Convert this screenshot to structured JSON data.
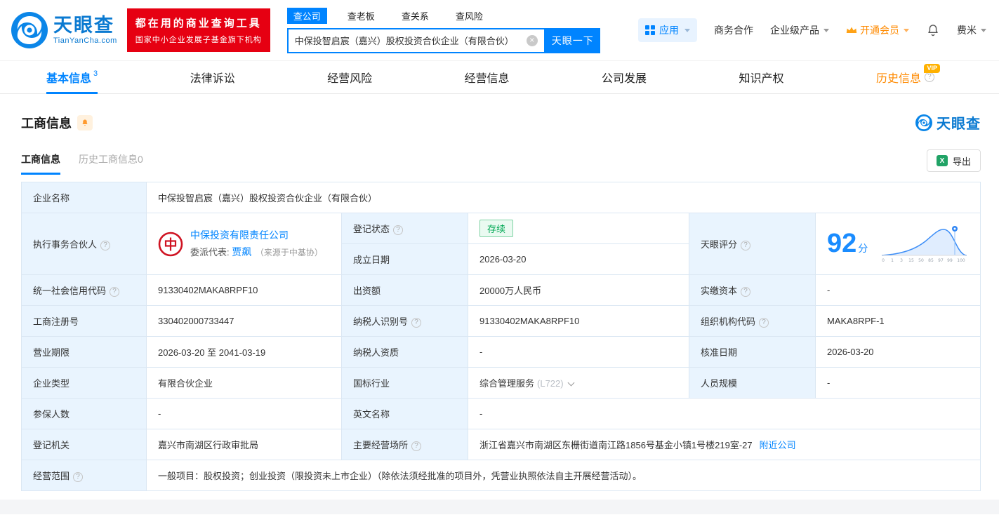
{
  "header": {
    "logo": {
      "brand": "天眼查",
      "domain": "TianYanCha.com"
    },
    "promo": {
      "line1": "都在用的商业查询工具",
      "line2": "国家中小企业发展子基金旗下机构"
    },
    "search": {
      "tabs": [
        {
          "label": "查公司"
        },
        {
          "label": "查老板"
        },
        {
          "label": "查关系"
        },
        {
          "label": "查风险"
        }
      ],
      "value": "中保投智启宸（嘉兴）股权投资合伙企业（有限合伙）",
      "button": "天眼一下"
    },
    "nav": {
      "apps": "应用",
      "business": "商务合作",
      "enterprise": "企业级产品",
      "vip": "开通会员",
      "user": "费米"
    }
  },
  "nav_tabs": [
    {
      "label": "基本信息",
      "count": "3"
    },
    {
      "label": "法律诉讼"
    },
    {
      "label": "经营风险"
    },
    {
      "label": "经营信息"
    },
    {
      "label": "公司发展"
    },
    {
      "label": "知识产权"
    },
    {
      "label": "历史信息",
      "badge": "VIP"
    }
  ],
  "section": {
    "title": "工商信息",
    "brand": "天眼查",
    "subtabs": [
      {
        "label": "工商信息"
      },
      {
        "label": "历史工商信息0"
      }
    ],
    "export_label": "导出"
  },
  "info": {
    "company_name_label": "企业名称",
    "company_name": "中保投智启宸（嘉兴）股权投资合伙企业（有限合伙）",
    "partner_label": "执行事务合伙人",
    "partner_company": "中保投资有限责任公司",
    "partner_rep_label": "委派代表:",
    "partner_rep": "贾飙",
    "partner_rep_source": "（来源于中基协）",
    "reg_status_label": "登记状态",
    "reg_status": "存续",
    "est_date_label": "成立日期",
    "est_date": "2026-03-20",
    "score_label": "天眼评分",
    "score": "92",
    "score_unit": "分",
    "score_axis": [
      "0",
      "1",
      "3",
      "15",
      "50",
      "85",
      "97",
      "99",
      "100"
    ],
    "credit_code_label": "统一社会信用代码",
    "credit_code": "91330402MAKA8RPF10",
    "capital_label": "出资额",
    "capital": "20000万人民币",
    "paid_capital_label": "实缴资本",
    "paid_capital": "-",
    "reg_no_label": "工商注册号",
    "reg_no": "330402000733447",
    "tax_id_label": "纳税人识别号",
    "tax_id": "91330402MAKA8RPF10",
    "org_code_label": "组织机构代码",
    "org_code": "MAKA8RPF-1",
    "term_label": "营业期限",
    "term": "2026-03-20 至 2041-03-19",
    "tax_quality_label": "纳税人资质",
    "tax_quality": "-",
    "approval_date_label": "核准日期",
    "approval_date": "2026-03-20",
    "company_type_label": "企业类型",
    "company_type": "有限合伙企业",
    "industry_label": "国标行业",
    "industry": "综合管理服务",
    "industry_code": "(L722)",
    "staff_size_label": "人员规模",
    "staff_size": "-",
    "insured_label": "参保人数",
    "insured": "-",
    "english_name_label": "英文名称",
    "english_name": "-",
    "authority_label": "登记机关",
    "authority": "嘉兴市南湖区行政审批局",
    "address_label": "主要经营场所",
    "address": "浙江省嘉兴市南湖区东栅街道南江路1856号基金小镇1号楼219室-27",
    "nearby_link": "附近公司",
    "scope_label": "经营范围",
    "scope": "一般项目：股权投资；创业投资（限投资未上市企业）（除依法须经批准的项目外，凭营业执照依法自主开展经营活动）。"
  },
  "colors": {
    "accent_blue": "#0084ff",
    "promo_red": "#e60012",
    "vip_orange": "#ff8a00",
    "status_green": "#00a854",
    "label_cell_bg": "#e9f4fe"
  }
}
